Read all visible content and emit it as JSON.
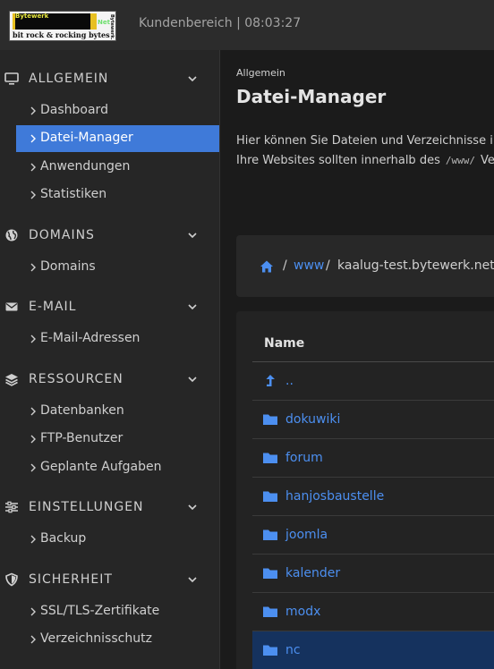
{
  "header": {
    "title": "Kundenbereich | 08:03:27",
    "logo": {
      "brand_left": "Bytewerk",
      "brand_right": "Net",
      "slogan": "bit rock & rocking bytes",
      "vertical": "Bytewerk.Net"
    }
  },
  "sidebar": {
    "sections": [
      {
        "label": "ALLGEMEIN",
        "icon": "monitor-icon",
        "items": [
          "Dashboard",
          "Datei-Manager",
          "Anwendungen",
          "Statistiken"
        ]
      },
      {
        "label": "DOMAINS",
        "icon": "globe-icon",
        "items": [
          "Domains"
        ]
      },
      {
        "label": "E-MAIL",
        "icon": "envelope-icon",
        "items": [
          "E-Mail-Adressen"
        ]
      },
      {
        "label": "RESSOURCEN",
        "icon": "layers-icon",
        "items": [
          "Datenbanken",
          "FTP-Benutzer",
          "Geplante Aufgaben"
        ]
      },
      {
        "label": "EINSTELLUNGEN",
        "icon": "sliders-icon",
        "items": [
          "Backup"
        ]
      },
      {
        "label": "SICHERHEIT",
        "icon": "shield-icon",
        "items": [
          "SSL/TLS-Zertifikate",
          "Verzeichnisschutz"
        ]
      }
    ],
    "active_item": "Datei-Manager"
  },
  "main": {
    "breadcrumb": "Allgemein",
    "title": "Datei-Manager",
    "description_line1": "Hier können Sie Dateien und Verzeichnisse in I",
    "description_line2_pre": "Ihre Websites sollten innerhalb des",
    "description_line2_code": "/www/",
    "description_line2_post": "Ve",
    "path": {
      "separator": "/",
      "root": "www",
      "current": "kaalug-test.bytewerk.net"
    },
    "table": {
      "column_name": "Name",
      "rows": [
        {
          "name": "..",
          "icon": "level-up-icon"
        },
        {
          "name": "dokuwiki",
          "icon": "folder-icon"
        },
        {
          "name": "forum",
          "icon": "folder-icon"
        },
        {
          "name": "hanjosbaustelle",
          "icon": "folder-icon"
        },
        {
          "name": "joomla",
          "icon": "folder-icon"
        },
        {
          "name": "kalender",
          "icon": "folder-icon"
        },
        {
          "name": "modx",
          "icon": "folder-icon"
        },
        {
          "name": "nc",
          "icon": "folder-icon"
        }
      ],
      "selected_row": "nc"
    }
  },
  "colors": {
    "accent": "#3f7ad9",
    "link": "#4c8ff0",
    "sidebar_bg": "#262626",
    "main_bg": "#1b1b1b"
  }
}
